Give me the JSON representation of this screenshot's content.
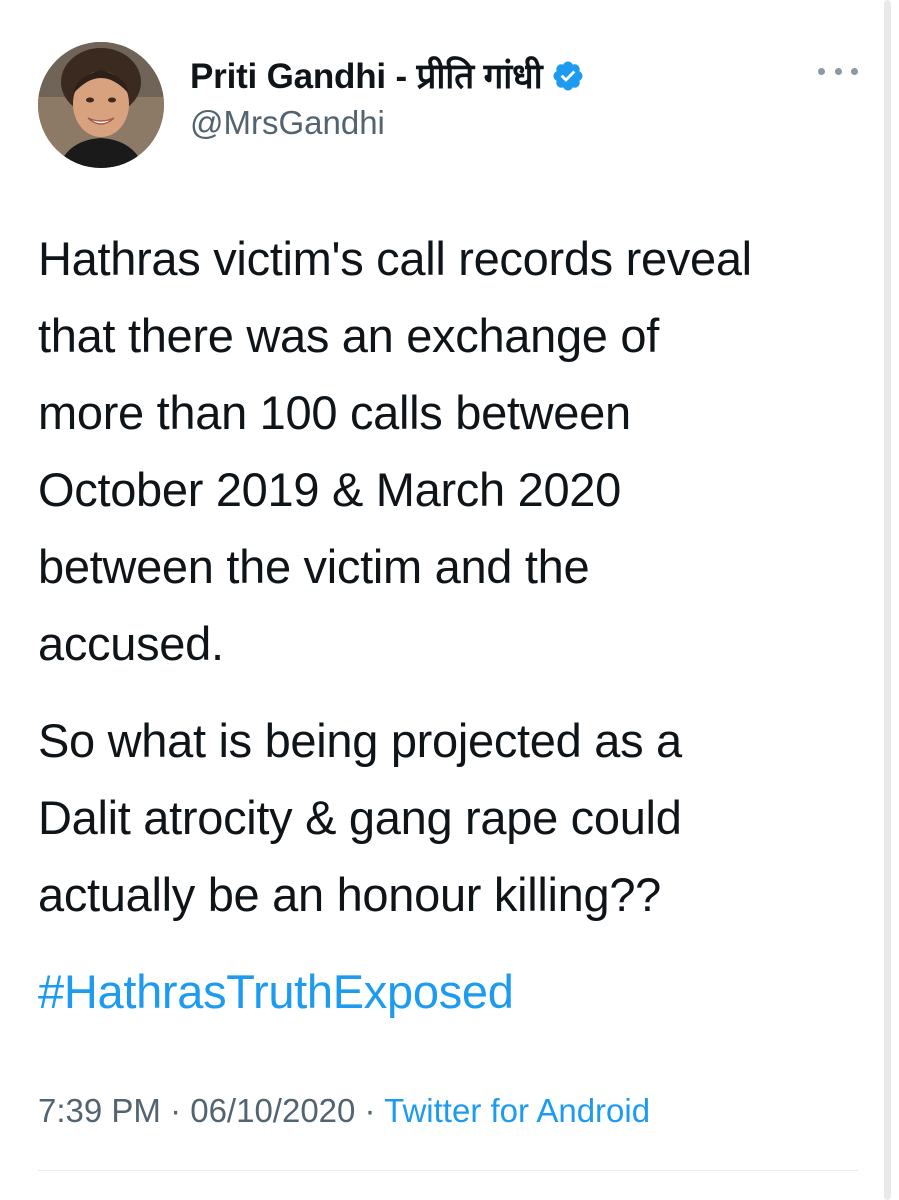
{
  "tweet": {
    "author": {
      "display_name": "Priti Gandhi - प्रीति गांधी",
      "handle": "@MrsGandhi",
      "verified": true,
      "avatar_icon": "profile-photo"
    },
    "more_icon": "more-options-icon",
    "paragraphs": [
      "Hathras victim's call records reveal\nthat there was an exchange of\nmore than 100 calls between\nOctober 2019 & March 2020\nbetween the victim and the\naccused.",
      "So what is being projected as a\nDalit atrocity & gang rape could\nactually be an honour killing??"
    ],
    "hashtag": "#HathrasTruthExposed",
    "timestamp": "7:39 PM · 06/10/2020 · ",
    "source": "Twitter for Android"
  },
  "colors": {
    "text": "#0f1419",
    "secondary": "#536471",
    "link": "#1d9bf0",
    "verified": "#1d9bf0"
  }
}
